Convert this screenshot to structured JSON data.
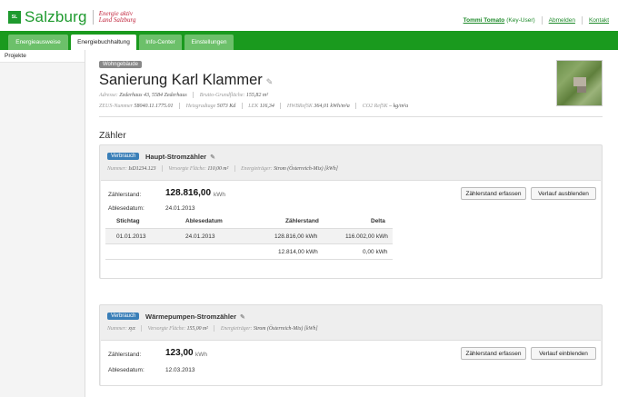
{
  "brand": {
    "logo_mark": "SL",
    "name": "Salzburg",
    "tagline_1": "Energie aktiv",
    "tagline_2": "Land Salzburg"
  },
  "topnav": {
    "user": "Tommi Tomato",
    "role": "(Key-User)",
    "logout": "Abmelden",
    "contact": "Kontakt"
  },
  "tabs": [
    {
      "label": "Energieausweise",
      "active": false
    },
    {
      "label": "Energiebuchhaltung",
      "active": true
    },
    {
      "label": "Info-Center",
      "active": false
    },
    {
      "label": "Einstellungen",
      "active": false
    }
  ],
  "sidebar": {
    "items": [
      {
        "label": "Projekte"
      }
    ]
  },
  "project": {
    "type_badge": "Wohngebäude",
    "title": "Sanierung Karl Klammer",
    "meta_line1": [
      {
        "label": "Adresse:",
        "value": "Zederhaus 43, 5584 Zederhaus"
      },
      {
        "label": "Brutto-Grundfläche:",
        "value": "155,82 m²"
      }
    ],
    "meta_line2": [
      {
        "label": "ZEUS-Nummer",
        "value": "58040.11.1775.01"
      },
      {
        "label": "Heizgradtage",
        "value": "5073 Kd"
      },
      {
        "label": "LEK",
        "value": "116,34"
      },
      {
        "label": "HWBRefSK",
        "value": "364,01 kWh/m²a"
      },
      {
        "label": "CO2 RefSK",
        "value": "– kg/m²a"
      }
    ]
  },
  "section_title": "Zähler",
  "meters": [
    {
      "badge": "Verbrauch",
      "name": "Haupt-Stromzähler",
      "meta": [
        {
          "label": "Nummer:",
          "value": "IsD1234.123"
        },
        {
          "label": "Versorgte Fläche:",
          "value": "110,00 m²"
        },
        {
          "label": "Energieträger:",
          "value": "Strom (Österreich-Mix) [kWh]"
        }
      ],
      "reading_label": "Zählerstand:",
      "reading_value": "128.816,00",
      "reading_unit": "kWh",
      "date_label": "Ablesedatum:",
      "date_value": "24.01.2013",
      "btn_enter": "Zählerstand erfassen",
      "btn_history": "Verlauf ausblenden",
      "table": {
        "headers": [
          "Stichtag",
          "Ablesedatum",
          "Zählerstand",
          "Delta"
        ],
        "rows": [
          [
            "01.01.2013",
            "24.01.2013",
            "128.816,00 kWh",
            "116.002,00 kWh"
          ],
          [
            "",
            "",
            "12.814,00 kWh",
            "0,00 kWh"
          ]
        ]
      }
    },
    {
      "badge": "Verbrauch",
      "name": "Wärmepumpen-Stromzähler",
      "meta": [
        {
          "label": "Nummer:",
          "value": "xyz"
        },
        {
          "label": "Versorgte Fläche:",
          "value": "155,00 m²"
        },
        {
          "label": "Energieträger:",
          "value": "Strom (Österreich-Mix) [kWh]"
        }
      ],
      "reading_label": "Zählerstand:",
      "reading_value": "123,00",
      "reading_unit": "kWh",
      "date_label": "Ablesedatum:",
      "date_value": "12.03.2013",
      "btn_enter": "Zählerstand erfassen",
      "btn_history": "Verlauf einblenden"
    }
  ],
  "colors": {
    "brand_green": "#1e9a2e",
    "tab_bar": "#1a9a1e",
    "badge_blue": "#3a7fb8"
  }
}
